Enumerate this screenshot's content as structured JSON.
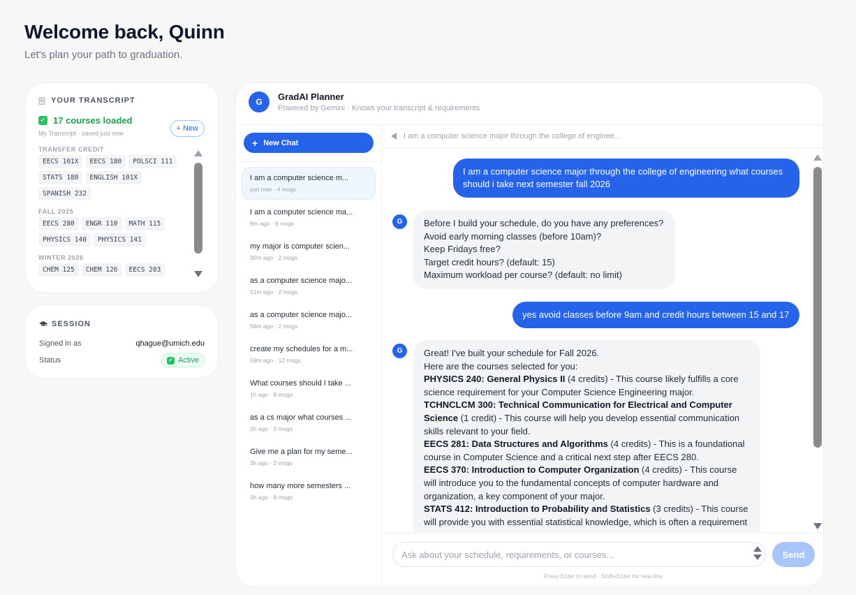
{
  "header": {
    "title": "Welcome back, Quinn",
    "subtitle": "Let's plan your path to graduation."
  },
  "transcript": {
    "title": "YOUR TRANSCRIPT",
    "status": "17 courses loaded",
    "meta": "My Transcript · saved just now",
    "new_label": "+ New",
    "terms": [
      {
        "name": "TRANSFER CREDIT",
        "courses": [
          "EECS 101X",
          "EECS 180",
          "POLSCI 111",
          "STATS 180",
          "ENGLISH 101X",
          "SPANISH 232"
        ]
      },
      {
        "name": "FALL 2025",
        "courses": [
          "EECS 280",
          "ENGR 110",
          "MATH 115",
          "PHYSICS 140",
          "PHYSICS 141"
        ]
      },
      {
        "name": "WINTER 2026",
        "courses": [
          "CHEM 125",
          "CHEM 126",
          "EECS 203"
        ]
      }
    ]
  },
  "session": {
    "title": "SESSION",
    "signed_in_label": "Signed in as",
    "signed_in_value": "qhague@umich.edu",
    "status_label": "Status",
    "status_value": "Active"
  },
  "planner": {
    "avatar": "G",
    "title": "GradAI Planner",
    "subtitle": "Powered by Gemini · Knows your transcript & requirements",
    "new_chat_label": "New Chat",
    "breadcrumb": "I am a computer science major through the college of enginee...",
    "history": [
      {
        "title": "I am a computer science m...",
        "meta": "just now · 4 msgs"
      },
      {
        "title": "I am a computer science ma...",
        "meta": "9m ago · 8 msgs"
      },
      {
        "title": "my major is computer scien...",
        "meta": "30m ago · 2 msgs"
      },
      {
        "title": "as a computer science majo...",
        "meta": "51m ago · 2 msgs"
      },
      {
        "title": "as a computer science majo...",
        "meta": "56m ago · 2 msgs"
      },
      {
        "title": "create my schedules for a m...",
        "meta": "59m ago · 12 msgs"
      },
      {
        "title": "What courses should I take ...",
        "meta": "1h ago · 8 msgs"
      },
      {
        "title": "as a cs major what courses ...",
        "meta": "2h ago · 2 msgs"
      },
      {
        "title": "Give me a plan for my seme...",
        "meta": "3h ago · 2 msgs"
      },
      {
        "title": "how many more semesters ...",
        "meta": "3h ago · 8 msgs"
      }
    ],
    "messages": {
      "user1_l1": "I am a computer science major through the college of engineering what courses",
      "user1_l2": "should i take next semester fall 2026",
      "bot1": [
        "Before I build your schedule, do you have any preferences?",
        "Avoid early morning classes (before 10am)?",
        "Keep Fridays free?",
        "Target credit hours? (default: 15)",
        "Maximum workload per course? (default: no limit)"
      ],
      "user2": "yes avoid classes before 9am and credit hours between 15 and 17",
      "bot2_intro": [
        "Great! I've built your schedule for Fall 2026.",
        "Here are the courses selected for you:"
      ],
      "c1_b": "PHYSICS 240: General Physics II",
      "c1_l1": " (4 credits) - This course likely fulfills a core",
      "c1_l2": "science requirement for your Computer Science Engineering major.",
      "c2_b1": "TCHNCLCM 300: Technical Communication for Electrical and Computer",
      "c2_b2": "Science",
      "c2_l1": " (1 credit) - This course will help you develop essential communication",
      "c2_l2": "skills relevant to your field.",
      "c3_b": "EECS 281: Data Structures and Algorithms",
      "c3_l1": " (4 credits) - This is a foundational",
      "c3_l2": "course in Computer Science and a critical next step after EECS 280.",
      "c4_b": "EECS 370: Introduction to Computer Organization",
      "c4_l1": " (4 credits) - This course",
      "c4_l2": "will introduce you to the fundamental concepts of computer hardware and",
      "c4_l3": "organization, a key component of your major.",
      "c5_b": "STATS 412: Introduction to Probability and Statistics",
      "c5_l1": " (3 credits) - This course",
      "c5_l2": "will provide you with essential statistical knowledge, which is often a requirement"
    },
    "input_placeholder": "Ask about your schedule, requirements, or courses...",
    "send_label": "Send",
    "hint": "Press Enter to send · Shift+Enter for new line"
  },
  "colors": {
    "accent": "#2563eb",
    "success": "#16a34a",
    "send_disabled": "#a7c4fb"
  }
}
